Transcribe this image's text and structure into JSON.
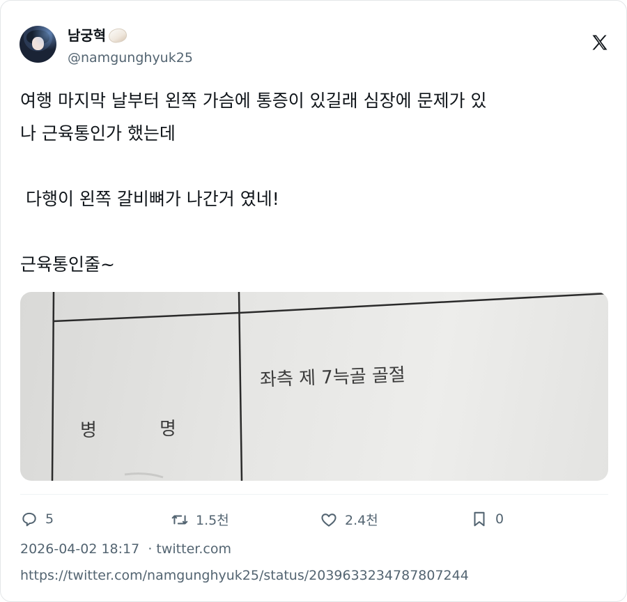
{
  "user": {
    "display_name": "남궁혁",
    "handle": "@namgunghyuk25"
  },
  "tweet": {
    "lines": [
      "여행 마지막 날부터 왼쪽 가슴에 통증이 있길래 심장에 문제가 있",
      "나 근육통인가 했는데",
      "",
      " 다행이 왼쪽 갈비뼈가 나간거 였네!",
      "",
      "근육통인줄~"
    ]
  },
  "media": {
    "diagnosis_text": "좌측 제 7늑골 골절",
    "field_label_1": "병",
    "field_label_2": "명"
  },
  "actions": {
    "reply_count": "5",
    "retweet_count": "1.5천",
    "like_count": "2.4천",
    "bookmark_count": "0"
  },
  "meta": {
    "timestamp": "2026-04-02 18:17",
    "separator": "·",
    "source": "twitter.com",
    "url": "https://twitter.com/namgunghyuk25/status/2039633234787807244"
  },
  "icons": {
    "badge": "shell-emoji-icon",
    "brand": "x-logo-icon"
  },
  "colors": {
    "text_primary": "#0f1419",
    "text_secondary": "#536471",
    "border": "#e3e6e8"
  }
}
